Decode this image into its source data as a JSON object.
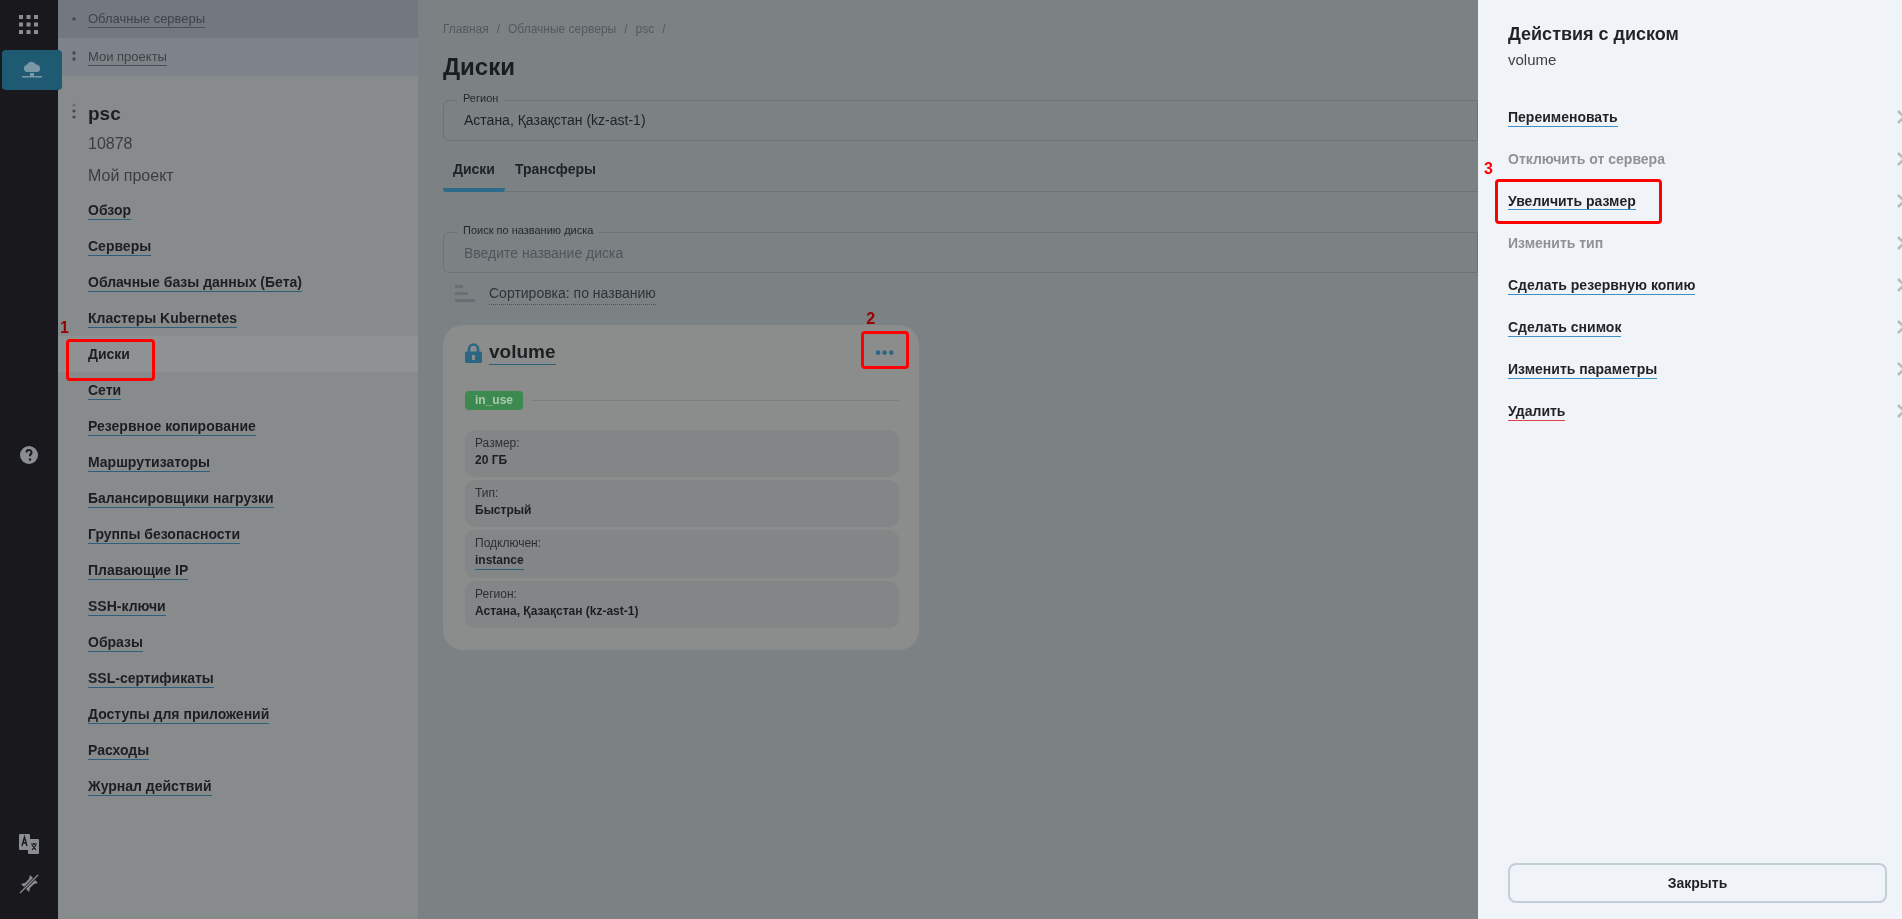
{
  "sidebar": {
    "crumbs": [
      {
        "label": "Облачные серверы"
      },
      {
        "label": "Мои проекты"
      }
    ],
    "project": {
      "name": "psc",
      "id": "10878",
      "description": "Мой проект"
    },
    "items": [
      {
        "label": "Обзор",
        "selected": false
      },
      {
        "label": "Серверы",
        "selected": false
      },
      {
        "label": "Облачные базы данных (Бета)",
        "selected": false
      },
      {
        "label": "Кластеры Kubernetes",
        "selected": false
      },
      {
        "label": "Диски",
        "selected": true,
        "callout": "1"
      },
      {
        "label": "Сети",
        "selected": false
      },
      {
        "label": "Резервное копирование",
        "selected": false
      },
      {
        "label": "Маршрутизаторы",
        "selected": false
      },
      {
        "label": "Балансировщики нагрузки",
        "selected": false
      },
      {
        "label": "Группы безопасности",
        "selected": false
      },
      {
        "label": "Плавающие IP",
        "selected": false
      },
      {
        "label": "SSH-ключи",
        "selected": false
      },
      {
        "label": "Образы",
        "selected": false
      },
      {
        "label": "SSL-сертификаты",
        "selected": false
      },
      {
        "label": "Доступы для приложений",
        "selected": false
      },
      {
        "label": "Расходы",
        "selected": false
      },
      {
        "label": "Журнал действий",
        "selected": false
      }
    ]
  },
  "main": {
    "breadcrumb": [
      "Главная",
      "Облачные серверы",
      "psc"
    ],
    "breadcrumb_separator": "/",
    "title": "Диски",
    "region": {
      "label": "Регион",
      "value": "Астана, Қазақстан (kz-ast-1)"
    },
    "tabs": [
      {
        "label": "Диски",
        "selected": true
      },
      {
        "label": "Трансферы",
        "selected": false
      }
    ],
    "search": {
      "label": "Поиск по названию диска",
      "placeholder": "Введите название диска"
    },
    "sort": {
      "label": "Сортировка: по названию"
    },
    "disks": [
      {
        "name": "volume",
        "locked": true,
        "status": "in_use",
        "color": "#3d8a50",
        "menu_callout": "2",
        "menu_icon": "•••",
        "fields": [
          {
            "label": "Размер:",
            "value": "20 ГБ",
            "kind": "text"
          },
          {
            "label": "Тип:",
            "value": "Быстрый",
            "kind": "text"
          },
          {
            "label": "Подключен:",
            "value": "instance",
            "kind": "link"
          },
          {
            "label": "Регион:",
            "value": "Астана, Қазақстан (kz-ast-1)",
            "kind": "text"
          }
        ]
      }
    ]
  },
  "panel": {
    "title": "Действия с диском",
    "subtitle": "volume",
    "actions": [
      {
        "label": "Переименовать",
        "disabled": false,
        "kind": "normal"
      },
      {
        "label": "Отключить от сервера",
        "disabled": true,
        "kind": "normal"
      },
      {
        "label": "Увеличить размер",
        "disabled": false,
        "kind": "normal",
        "callout": "3"
      },
      {
        "label": "Изменить тип",
        "disabled": true,
        "kind": "normal"
      },
      {
        "label": "Сделать резервную копию",
        "disabled": false,
        "kind": "normal"
      },
      {
        "label": "Сделать снимок",
        "disabled": false,
        "kind": "normal"
      },
      {
        "label": "Изменить параметры",
        "disabled": false,
        "kind": "normal"
      },
      {
        "label": "Удалить",
        "disabled": false,
        "kind": "danger"
      }
    ],
    "close": "Закрыть"
  }
}
